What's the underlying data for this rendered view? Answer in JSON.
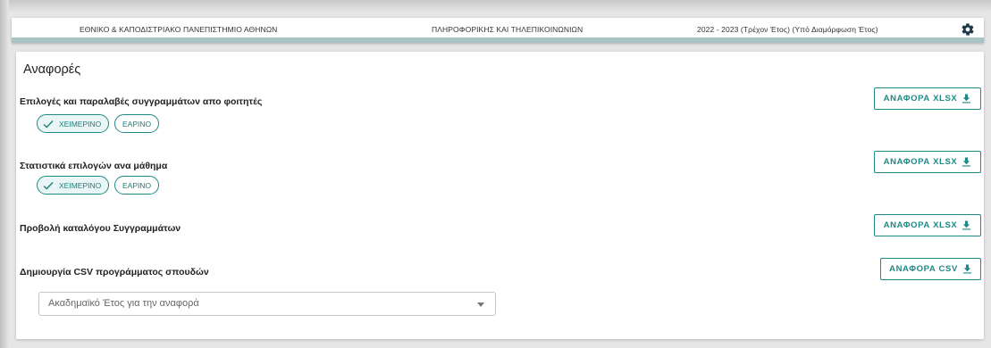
{
  "header": {
    "university": "ΕΘΝΙΚΟ & ΚΑΠΟΔΙΣΤΡΙΑΚΟ ΠΑΝΕΠΙΣΤΗΜΙΟ ΑΘΗΝΩΝ",
    "department": "ΠΛΗΡΟΦΟΡΙΚΗΣ ΚΑΙ ΤΗΛΕΠΙΚΟΙΝΩΝΙΩΝ",
    "academic_year": "2022 - 2023 (Τρέχον Έτος) (Υπό Διαμόρφωση Έτος)",
    "settings_icon": "gear-icon"
  },
  "page": {
    "title": "Αναφορές"
  },
  "reports": [
    {
      "title": "Επιλογές και παραλαβές συγγραμμάτων απο φοιτητές",
      "button_label": "ΑΝΑΦΟΡΑ XLSX",
      "chips": [
        {
          "label": "ΧΕΙΜΕΡΙΝΟ",
          "selected": true
        },
        {
          "label": "ΕΑΡΙΝΟ",
          "selected": false
        }
      ]
    },
    {
      "title": "Στατιστικά επιλογών ανα μάθημα",
      "button_label": "ΑΝΑΦΟΡΑ XLSX",
      "chips": [
        {
          "label": "ΧΕΙΜΕΡΙΝΟ",
          "selected": true
        },
        {
          "label": "ΕΑΡΙΝΟ",
          "selected": false
        }
      ]
    },
    {
      "title": "Προβολή καταλόγου Συγγραμμάτων",
      "button_label": "ΑΝΑΦΟΡΑ XLSX"
    },
    {
      "title": "Δημιουργία CSV προγράμματος σπουδών",
      "button_label": "ΑΝΑΦΟΡΑ CSV",
      "select_placeholder": "Ακαδημαϊκό Έτος για την αναφορά"
    }
  ],
  "colors": {
    "accent": "#1f8a86",
    "header_strip": "#a9c2c4"
  }
}
